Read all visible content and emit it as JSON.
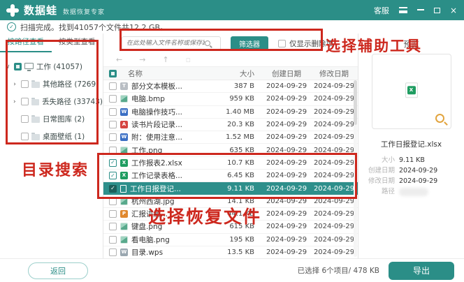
{
  "titlebar": {
    "brand": "数据蛙",
    "subtitle": "数据恢复专家",
    "support": "客服"
  },
  "statusbar": {
    "text": "扫描完成。找到41057个文件共12.2 GB。"
  },
  "toolbar": {
    "search_placeholder": "在此处输入文件名称或保存路径",
    "filter_label": "筛选器",
    "only_deleted_label": "仅显示删除项",
    "nav_icons": [
      "back-arrow-icon",
      "forward-arrow-icon",
      "up-arrow-icon"
    ],
    "view_icons": [
      "grid-view-icon",
      "list-view-icon",
      "detail-view-icon"
    ],
    "active_view": "detail-view-icon"
  },
  "sidebar": {
    "tabs": [
      {
        "label": "按路径查看",
        "active": true
      },
      {
        "label": "按类型查看",
        "active": false
      }
    ],
    "tree": [
      {
        "label": "工作 (41057)",
        "level": 0,
        "chevron": "∨",
        "checkbox": "partial",
        "icon": "computer-icon"
      },
      {
        "label": "其他路径 (7269)",
        "level": 1,
        "chevron": "›",
        "checkbox": "unchecked",
        "icon": "folder-icon"
      },
      {
        "label": "丢失路径 (33743)",
        "level": 1,
        "chevron": "›",
        "checkbox": "unchecked",
        "icon": "folder-icon"
      },
      {
        "label": "日常图库 (2)",
        "level": 1,
        "chevron": "",
        "checkbox": "unchecked",
        "icon": "folder-icon"
      },
      {
        "label": "桌面壁纸 (1)",
        "level": 1,
        "chevron": "",
        "checkbox": "unchecked",
        "icon": "folder-icon"
      }
    ]
  },
  "filelist": {
    "columns": [
      "名称",
      "大小",
      "创建日期",
      "修改日期"
    ],
    "icon_colors": {
      "excel": "#1f9d61",
      "word": "#3b6fc4",
      "ppt": "#e0892f",
      "pdf": "#d64541",
      "txt": "#b9bec4",
      "wps": "#9aa7b0"
    },
    "icon_letters": {
      "excel": "X",
      "word": "W",
      "ppt": "P",
      "pdf": "A",
      "txt": "T",
      "wps": "W"
    },
    "rows": [
      {
        "name": "部分文本模板...",
        "type": "txt",
        "size": "387  B",
        "created": "2024-09-29",
        "modified": "2024-09-29",
        "checked": false,
        "selected": false
      },
      {
        "name": "电脑.bmp",
        "type": "img",
        "size": "959 KB",
        "created": "2024-09-29",
        "modified": "2024-09-29",
        "checked": false,
        "selected": false
      },
      {
        "name": "电脑操作技巧...",
        "type": "word",
        "size": "1.40 MB",
        "created": "2024-09-29",
        "modified": "2024-09-29",
        "checked": false,
        "selected": false
      },
      {
        "name": "读书片段记录...",
        "type": "pdf",
        "size": "20.3 KB",
        "created": "2024-09-29",
        "modified": "2024-09-29",
        "checked": false,
        "selected": false
      },
      {
        "name": "附：使用注意...",
        "type": "word",
        "size": "1.52 MB",
        "created": "2024-09-29",
        "modified": "2024-09-29",
        "checked": false,
        "selected": false
      },
      {
        "name": "工作.png",
        "type": "img",
        "size": "635 KB",
        "created": "2024-09-29",
        "modified": "2024-09-29",
        "checked": false,
        "selected": false
      },
      {
        "name": "工作报表2.xlsx",
        "type": "excel",
        "size": "10.7 KB",
        "created": "2024-09-29",
        "modified": "2024-09-29",
        "checked": true,
        "selected": false
      },
      {
        "name": "工作记录表格...",
        "type": "excel",
        "size": "6.45 KB",
        "created": "2024-09-29",
        "modified": "2024-09-29",
        "checked": true,
        "selected": false
      },
      {
        "name": "工作日报登记...",
        "type": "doc",
        "size": "9.11 KB",
        "created": "2024-09-29",
        "modified": "2024-09-29",
        "checked": true,
        "selected": true
      },
      {
        "name": "杭州西湖.jpg",
        "type": "img",
        "size": "14.1 KB",
        "created": "2024-09-29",
        "modified": "2024-09-29",
        "checked": false,
        "selected": false
      },
      {
        "name": "汇报讲解...",
        "type": "ppt",
        "size": "44.1 KB",
        "created": "2024-09-29",
        "modified": "2024-09-29",
        "checked": false,
        "selected": false
      },
      {
        "name": "键盘.png",
        "type": "img",
        "size": "615 KB",
        "created": "2024-09-29",
        "modified": "2024-09-29",
        "checked": false,
        "selected": false
      },
      {
        "name": "看电脑.png",
        "type": "img",
        "size": "195 KB",
        "created": "2024-09-29",
        "modified": "2024-09-29",
        "checked": false,
        "selected": false
      },
      {
        "name": "目录.wps",
        "type": "wps",
        "size": "13.5 KB",
        "created": "2024-09-29",
        "modified": "2024-09-29",
        "checked": false,
        "selected": false
      }
    ]
  },
  "preview": {
    "title": "预览",
    "filename": "工作日报登记.xlsx",
    "meta": [
      {
        "label": "大小",
        "value": "9.11 KB"
      },
      {
        "label": "创建日期",
        "value": "2024-09-29"
      },
      {
        "label": "修改日期",
        "value": "2024-09-29"
      },
      {
        "label": "路径",
        "value": ""
      }
    ]
  },
  "bottombar": {
    "back_label": "返回",
    "selection_text": "已选择 6个项目/ 478 KB",
    "export_label": "导出"
  },
  "annotations": {
    "tool_text": "选择辅助工具",
    "dir_text": "目录搜索",
    "files_text": "选择恢复文件",
    "red": "#cd281e"
  },
  "colors": {
    "brand_teal": "#2b8e87",
    "selected_row": "#2e8f8b",
    "annotation_red": "#cd281e",
    "magnifier_orange": "#e2a43e",
    "excel_green": "#1f9d61"
  }
}
